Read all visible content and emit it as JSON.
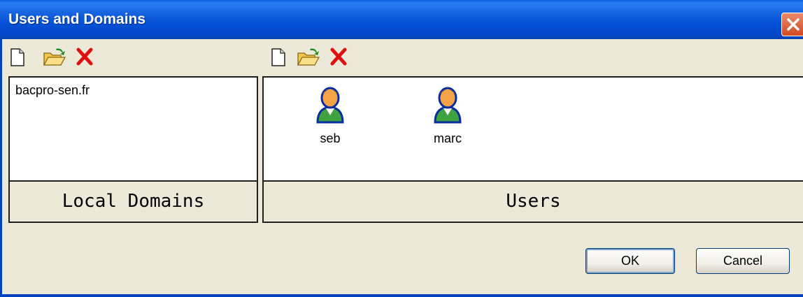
{
  "window": {
    "title": "Users and Domains"
  },
  "domains": {
    "items": [
      "bacpro-sen.fr"
    ],
    "label": "Local Domains"
  },
  "users": {
    "items": [
      {
        "name": "seb"
      },
      {
        "name": "marc"
      }
    ],
    "label": "Users"
  },
  "buttons": {
    "ok": "OK",
    "cancel": "Cancel"
  },
  "icons": {
    "toolbar": [
      "new-icon",
      "open-folder-icon",
      "delete-icon"
    ],
    "user": "user-icon",
    "close": "close-icon"
  },
  "colors": {
    "titlebar": "#0452d6",
    "dialog_bg": "#ece9d8",
    "delete_red": "#e01010",
    "close_btn": "#d04a22"
  }
}
